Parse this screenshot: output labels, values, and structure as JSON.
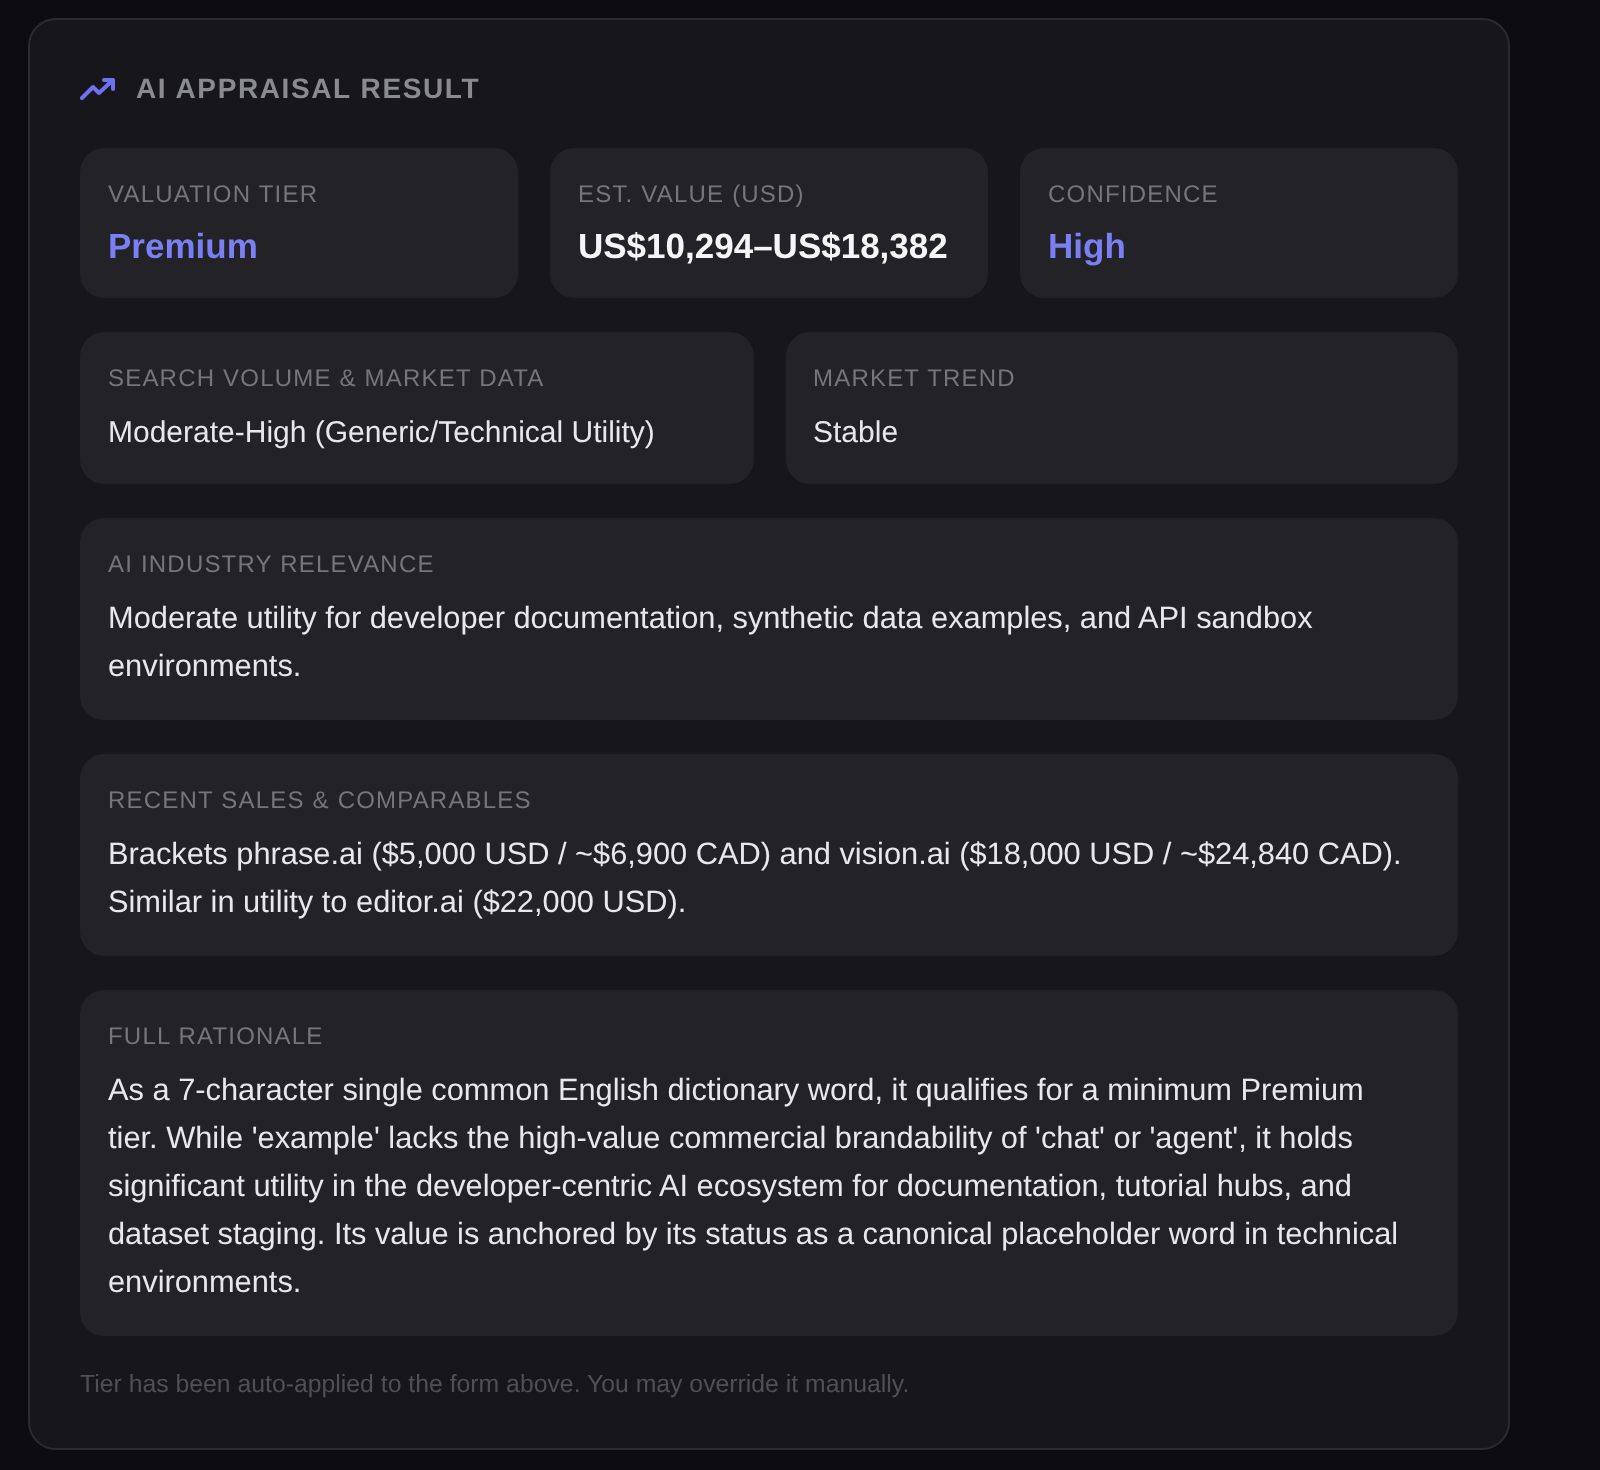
{
  "panel": {
    "title": "AI APPRAISAL RESULT",
    "summary": [
      {
        "label": "VALUATION TIER",
        "value": "Premium",
        "accent": true
      },
      {
        "label": "EST. VALUE (USD)",
        "value": "US$10,294–US$18,382",
        "accent": false
      },
      {
        "label": "CONFIDENCE",
        "value": "High",
        "accent": true
      }
    ],
    "market": [
      {
        "label": "SEARCH VOLUME & MARKET DATA",
        "value": "Moderate-High (Generic/Technical Utility)"
      },
      {
        "label": "MARKET TREND",
        "value": "Stable"
      }
    ],
    "sections": [
      {
        "label": "AI INDUSTRY RELEVANCE",
        "text": "Moderate utility for developer documentation, synthetic data examples, and API sandbox environments."
      },
      {
        "label": "RECENT SALES & COMPARABLES",
        "text": "Brackets phrase.ai ($5,000 USD / ~$6,900 CAD) and vision.ai ($18,000 USD / ~$24,840 CAD). Similar in utility to editor.ai ($22,000 USD)."
      },
      {
        "label": "FULL RATIONALE",
        "text": "As a 7-character single common English dictionary word, it qualifies for a minimum Premium tier. While 'example' lacks the high-value commercial brandability of 'chat' or 'agent', it holds significant utility in the developer-centric AI ecosystem for documentation, tutorial hubs, and dataset staging. Its value is anchored by its status as a canonical placeholder word in technical environments."
      }
    ],
    "footnote": "Tier has been auto-applied to the form above. You may override it manually."
  }
}
